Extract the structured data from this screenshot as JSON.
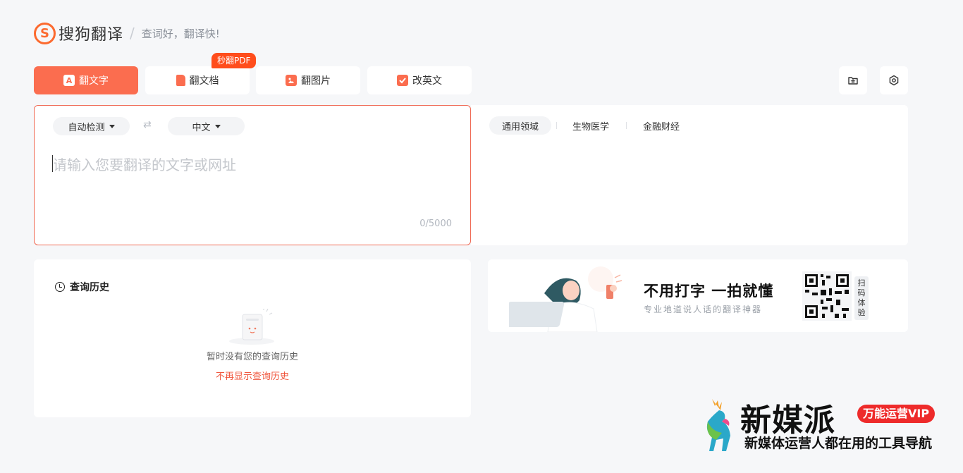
{
  "header": {
    "logo_letter": "S",
    "brand": "搜狗翻译",
    "slogan": "查词好，翻译快!"
  },
  "tabs": [
    {
      "label": "翻文字",
      "icon": "text-translate-icon",
      "active": true
    },
    {
      "label": "翻文档",
      "icon": "document-icon",
      "active": false
    },
    {
      "label": "翻图片",
      "icon": "image-icon",
      "active": false
    },
    {
      "label": "改英文",
      "icon": "edit-english-icon",
      "active": false
    }
  ],
  "badge": "秒翻PDF",
  "toolbar": {
    "favorites_icon": "star-folder-icon",
    "settings_icon": "gear-icon"
  },
  "input": {
    "source_lang": "自动检测",
    "target_lang": "中文",
    "swap_icon": "⇄",
    "placeholder": "请输入您要翻译的文字或网址",
    "char_count": "0/5000"
  },
  "domains": [
    {
      "label": "通用领域",
      "active": true
    },
    {
      "label": "生物医学",
      "active": false
    },
    {
      "label": "金融财经",
      "active": false
    }
  ],
  "history": {
    "title": "查询历史",
    "empty_text": "暂时没有您的查询历史",
    "hide_link": "不再显示查询历史"
  },
  "banner": {
    "title": "不用打字  一拍就懂",
    "subtitle": "专业地道说人话的翻译神器",
    "scan_text": "扫码体验"
  },
  "watermark": {
    "title": "新媒派",
    "vip": "万能运营VIP",
    "subtitle": "新媒体运营人都在用的工具导航"
  },
  "colors": {
    "accent": "#fb6d4f",
    "badge": "#ff4d1c",
    "link": "#f0553c"
  }
}
